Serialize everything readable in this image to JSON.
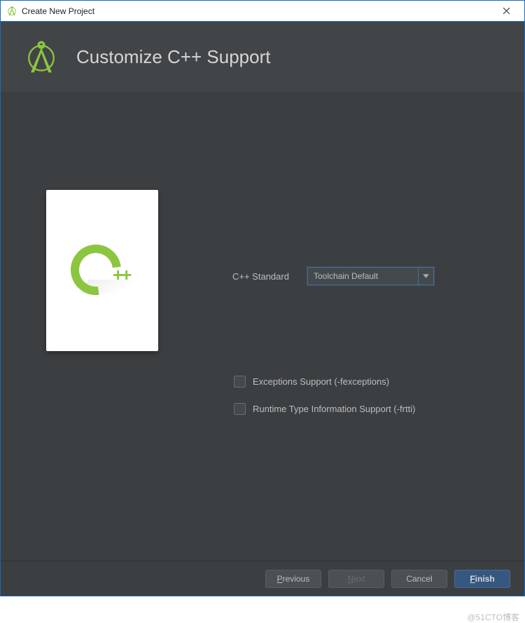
{
  "title_bar": {
    "text": "Create New Project"
  },
  "header": {
    "title": "Customize C++ Support"
  },
  "standard": {
    "label": "C++ Standard",
    "selected": "Toolchain Default"
  },
  "options": {
    "exceptions": {
      "label": "Exceptions Support (-fexceptions)",
      "checked": false
    },
    "rtti": {
      "label": "Runtime Type Information Support (-frtti)",
      "checked": false
    }
  },
  "footer": {
    "previous_prefix": "P",
    "previous_rest": "revious",
    "next_prefix": "N",
    "next_rest": "ext",
    "cancel": "Cancel",
    "finish_prefix": "F",
    "finish_rest": "inish"
  },
  "watermark": "@51CTO博客"
}
